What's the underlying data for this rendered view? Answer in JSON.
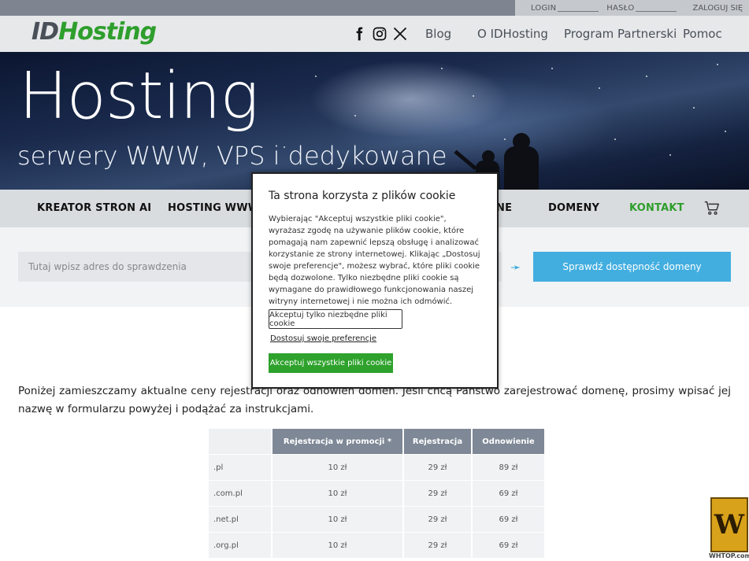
{
  "login": {
    "login_label": "LOGIN",
    "password_label": "HASŁO",
    "login_button": "ZALOGUJ SIĘ"
  },
  "header": {
    "logo_id": "ID",
    "logo_hosting": "Hosting",
    "social": [
      "facebook-icon",
      "instagram-icon",
      "x-icon"
    ],
    "nav": [
      "Blog",
      "O IDHosting",
      "Program Partnerski",
      "Pomoc"
    ]
  },
  "hero": {
    "title": "Hosting",
    "subtitle": "serwery WWW, VPS i dedykowane"
  },
  "catnav": {
    "items": [
      "KREATOR STRON AI",
      "HOSTING WWW",
      "NE",
      "DOMENY",
      "KONTAKT"
    ],
    "accent": "#2e9e2c"
  },
  "search": {
    "placeholder": "Tutaj wpisz adres do sprawdzenia",
    "button": "Sprawdź dostępność domeny"
  },
  "description": "Poniżej zamieszczamy aktualne ceny rejestracji oraz odnowień domen. Jeśli chcą Państwo zarejestrować domenę, prosimy wpisać jej nazwę w formularzu powyżej i podążać za instrukcjami.",
  "price_table": {
    "headers": [
      "",
      "Rejestracja w promocji *",
      "Rejestracja",
      "Odnowienie"
    ],
    "rows": [
      [
        ".pl",
        "10 zł",
        "29 zł",
        "89 zł"
      ],
      [
        ".com.pl",
        "10 zł",
        "29 zł",
        "69 zł"
      ],
      [
        ".net.pl",
        "10 zł",
        "29 zł",
        "69 zł"
      ],
      [
        ".org.pl",
        "10 zł",
        "29 zł",
        "69 zł"
      ]
    ]
  },
  "cookie": {
    "title": "Ta strona korzysta z plików cookie",
    "body": "Wybierając \"Akceptuj wszystkie pliki cookie\", wyrażasz zgodę na używanie plików cookie, które pomagają nam zapewnić lepszą obsługę i analizować korzystanie ze strony internetowej. Klikając „Dostosuj swoje preferencje\", możesz wybrać, które pliki cookie będą dozwolone. Tylko niezbędne pliki cookie są wymagane do prawidłowego funkcjonowania naszej witryny internetowej i nie można ich odmówić.",
    "btn_necessary": "Akceptuj tylko niezbędne pliki cookie",
    "btn_preferences": "Dostosuj swoje preferencje",
    "btn_all": "Akceptuj wszystkie pliki cookie",
    "accent": "#2ea22c"
  },
  "watermark": {
    "text": "WHTOP.com"
  }
}
